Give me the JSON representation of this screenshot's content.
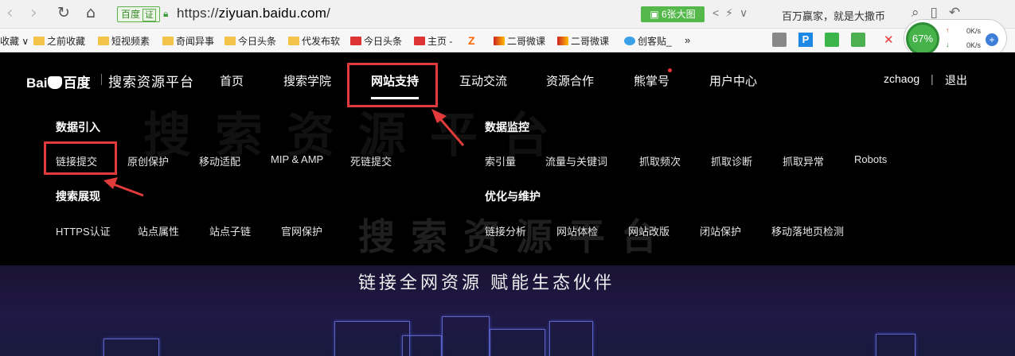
{
  "browser": {
    "site_badge": "百度",
    "site_badge_tag": "证",
    "url_scheme": "https://",
    "url_host": "ziyuan.baidu.com",
    "url_path": "/",
    "image_button": "6张大图",
    "news_text": "百万赢家，就是大撒币",
    "bookmarks": [
      {
        "label": "收藏",
        "type": "folder-arrow"
      },
      {
        "label": "之前收藏",
        "type": "folder"
      },
      {
        "label": "短视频素",
        "type": "folder"
      },
      {
        "label": "奇闻异事",
        "type": "folder"
      },
      {
        "label": "今日头条",
        "type": "folder"
      },
      {
        "label": "代发布软",
        "type": "folder"
      },
      {
        "label": "今日头条",
        "type": "fav"
      },
      {
        "label": "主页 -",
        "type": "fav"
      },
      {
        "label": "二哥微课",
        "type": "fav"
      },
      {
        "label": "二哥微课",
        "type": "fav"
      },
      {
        "label": "创客贴_",
        "type": "fav"
      }
    ],
    "bookmarks_more": "»",
    "speed": {
      "percent": "67%",
      "up": "0K/s",
      "down": "0K/s"
    }
  },
  "header": {
    "logo": "Bai百度",
    "title": "搜索资源平台",
    "nav": [
      {
        "label": "首页"
      },
      {
        "label": "搜索学院"
      },
      {
        "label": "网站支持"
      },
      {
        "label": "互动交流"
      },
      {
        "label": "资源合作"
      },
      {
        "label": "熊掌号"
      },
      {
        "label": "用户中心"
      }
    ],
    "username": "zchaog",
    "separator": "|",
    "logout": "退出"
  },
  "dropdown": {
    "groups": [
      {
        "title": "数据引入",
        "items": [
          "链接提交",
          "原创保护",
          "移动适配",
          "MIP & AMP",
          "死链提交"
        ]
      },
      {
        "title": "数据监控",
        "items": [
          "索引量",
          "流量与关键词",
          "抓取频次",
          "抓取诊断",
          "抓取异常",
          "Robots"
        ]
      },
      {
        "title": "搜索展现",
        "items": [
          "HTTPS认证",
          "站点属性",
          "站点子链",
          "官网保护"
        ]
      },
      {
        "title": "优化与维护",
        "items": [
          "链接分析",
          "网站体检",
          "网站改版",
          "闭站保护",
          "移动落地页检测"
        ]
      }
    ]
  },
  "hero": {
    "watermark": "搜索资源平台",
    "slogan": "链接全网资源 赋能生态伙伴"
  },
  "colors": {
    "annotation_red": "#e03a3a",
    "page_bg": "#000000",
    "badge_green": "#55b84a"
  }
}
